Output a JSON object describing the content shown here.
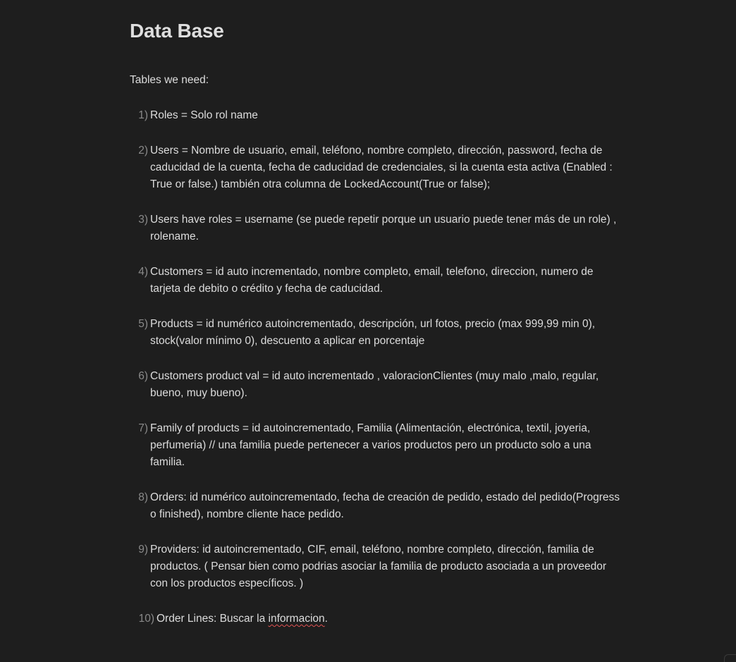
{
  "doc": {
    "title": "Data Base",
    "intro": "Tables we need:"
  },
  "items": [
    {
      "num": "1)",
      "text": "Roles =  Solo rol name"
    },
    {
      "num": "2)",
      "text": "Users =  Nombre de usuario, email, teléfono, nombre completo, dirección, password, fecha de caducidad de la cuenta, fecha de caducidad de credenciales, si la cuenta esta activa (Enabled : True or false.) también otra columna de LockedAccount(True or false);"
    },
    {
      "num": "3)",
      "text": "Users have roles = username (se puede repetir porque un usuario puede tener más de un role) , rolename."
    },
    {
      "num": "4)",
      "text": "Customers = id auto incrementado, nombre completo, email, telefono, direccion, numero de tarjeta de debito o crédito y fecha de caducidad."
    },
    {
      "num": "5)",
      "text": " Products = id numérico autoincrementado, descripción, url fotos, precio (max 999,99 min 0), stock(valor mínimo 0), descuento a aplicar en porcentaje"
    },
    {
      "num": "6)",
      "text": "Customers product val =  id auto incrementado , valoracionClientes (muy malo ,malo, regular, bueno, muy bueno)."
    },
    {
      "num": "7)",
      "text": "Family of products = id autoincrementado, Familia (Alimentación, electrónica, textil, joyeria, perfumeria) // una familia puede pertenecer a  varios productos pero un producto solo a una familia."
    },
    {
      "num": "8)",
      "text": "Orders: id numérico autoincrementado,  fecha de creación de pedido, estado del pedido(Progress o finished), nombre cliente hace pedido."
    },
    {
      "num": "9)",
      "text": "Providers: id autoincrementado, CIF, email, teléfono, nombre completo, dirección, familia de productos. ( Pensar bien como podrias asociar la familia de producto asociada a un proveedor con los productos específicos. )"
    },
    {
      "num": "10)",
      "text_before": "Order Lines: Buscar la ",
      "text_typo": "informacion",
      "text_after": "."
    }
  ]
}
